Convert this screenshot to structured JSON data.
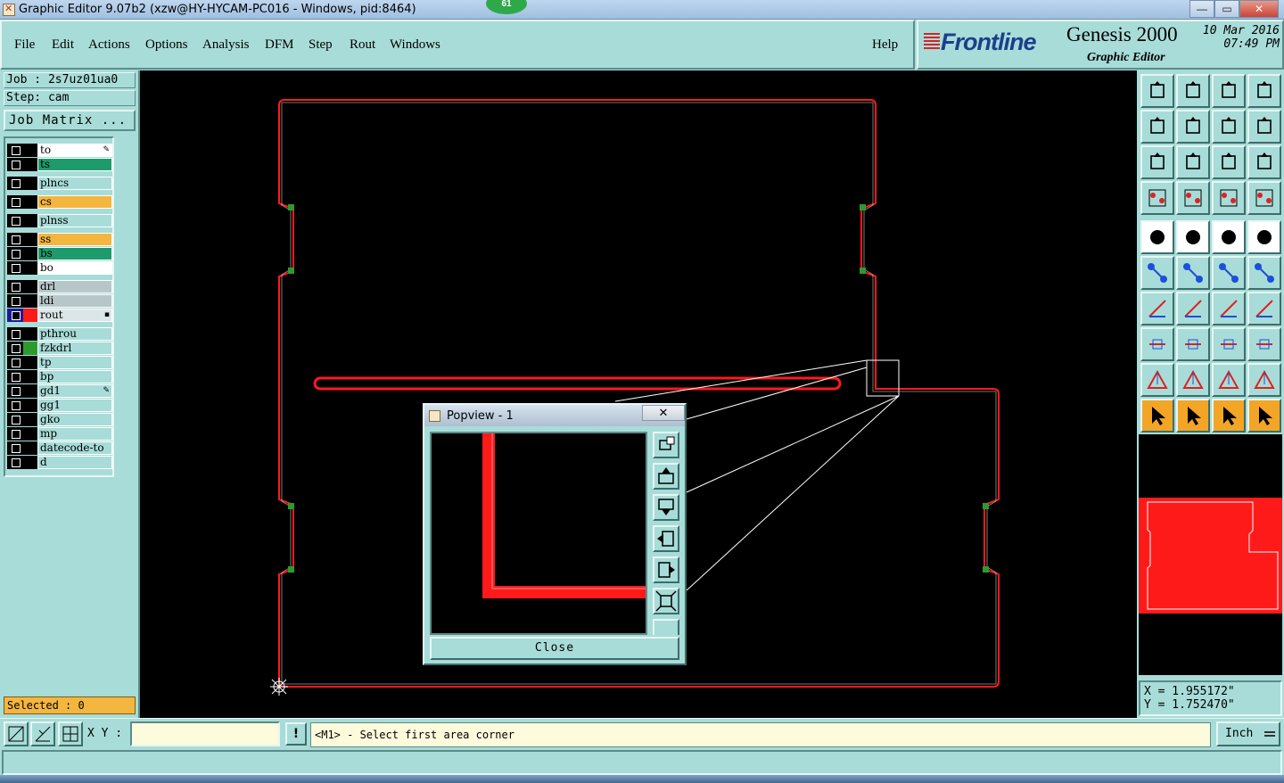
{
  "window": {
    "title": "Graphic Editor 9.07b2 (xzw@HY-HYCAM-PC016 - Windows, pid:8464)",
    "badge": "61",
    "minimize": "—",
    "maximize": "▭",
    "close": "✕"
  },
  "menu": {
    "file": "File",
    "edit": "Edit",
    "actions": "Actions",
    "options": "Options",
    "analysis": "Analysis",
    "dfm": "DFM",
    "step": "Step",
    "rout": "Rout",
    "windows": "Windows",
    "help": "Help"
  },
  "brand": {
    "logo": "Frontline",
    "product": "Genesis 2000",
    "subtitle": "Graphic Editor",
    "date": "10 Mar 2016",
    "time": "07:49 PM"
  },
  "job": {
    "job_label": "Job : 2s7uz01ua0",
    "step_label": "Step: cam",
    "matrix_button": "Job Matrix ..."
  },
  "layers": [
    {
      "name": "to",
      "bg": "#ffffff",
      "flag": "✎"
    },
    {
      "name": "ts",
      "bg": "#1d9b6c",
      "flag": ""
    },
    {
      "name": "plncs",
      "bg": "#a8dcd8",
      "flag": ""
    },
    {
      "name": "cs",
      "bg": "#f3b63e",
      "flag": ""
    },
    {
      "name": "plnss",
      "bg": "#a8dcd8",
      "flag": ""
    },
    {
      "name": "ss",
      "bg": "#f3b63e",
      "flag": ""
    },
    {
      "name": "bs",
      "bg": "#1d9b6c",
      "flag": ""
    },
    {
      "name": "bo",
      "bg": "#ffffff",
      "flag": ""
    },
    {
      "name": "drl",
      "bg": "#b7c7c9",
      "flag": ""
    },
    {
      "name": "ldi",
      "bg": "#b7c7c9",
      "flag": ""
    },
    {
      "name": "rout",
      "bg": "#dce6e6",
      "flag": "▪"
    },
    {
      "name": "pthrou",
      "bg": "#a8dcd8",
      "flag": ""
    },
    {
      "name": "fzkdrl",
      "bg": "#a8dcd8",
      "flag": ""
    },
    {
      "name": "tp",
      "bg": "#a8dcd8",
      "flag": ""
    },
    {
      "name": "bp",
      "bg": "#a8dcd8",
      "flag": ""
    },
    {
      "name": "gd1",
      "bg": "#a8dcd8",
      "flag": "✎"
    },
    {
      "name": "gg1",
      "bg": "#a8dcd8",
      "flag": ""
    },
    {
      "name": "gko",
      "bg": "#a8dcd8",
      "flag": ""
    },
    {
      "name": "mp",
      "bg": "#a8dcd8",
      "flag": ""
    },
    {
      "name": "datecode-to",
      "bg": "#a8dcd8",
      "flag": ""
    },
    {
      "name": "d",
      "bg": "#a8dcd8",
      "flag": ""
    }
  ],
  "selected": "Selected : 0",
  "popview": {
    "title": "Popview - 1",
    "close_x": "✕",
    "close_button": "Close"
  },
  "coords": {
    "x": "X = 1.955172\"",
    "y": "Y = 1.752470\""
  },
  "bottom": {
    "xy_label": "X Y :",
    "xy_value": "",
    "excl": "!",
    "prompt": "<M1> - Select first area corner",
    "units": "Inch"
  },
  "colors": {
    "panel": "#a8dcd8",
    "outline": "#ff1a1a",
    "canvas": "#000000"
  }
}
